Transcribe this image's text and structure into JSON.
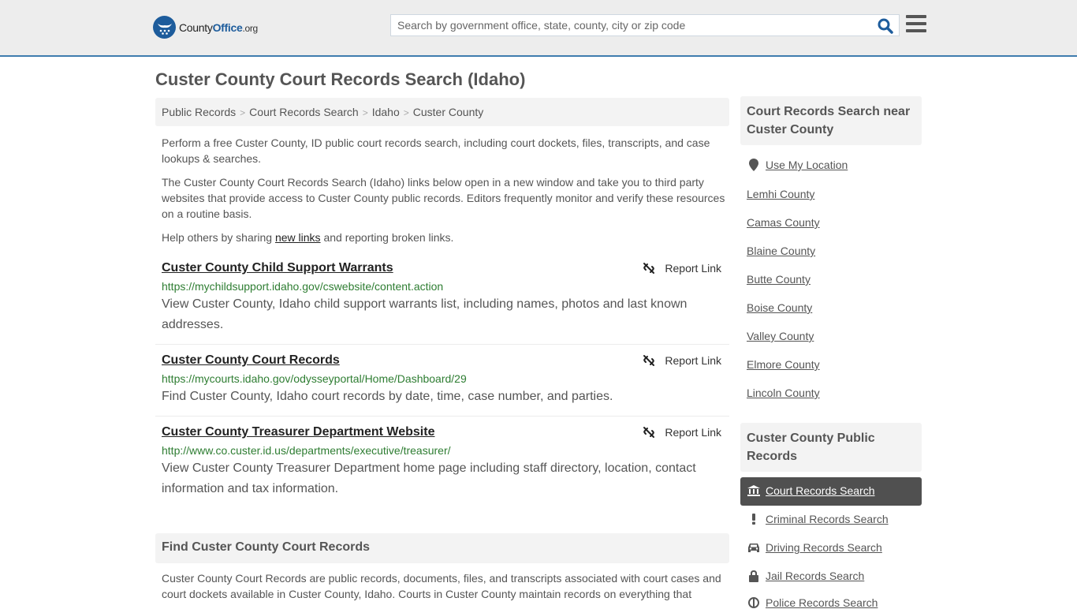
{
  "header": {
    "logo": {
      "name_part1": "County",
      "name_part2": "Office",
      "name_part3": ".org"
    },
    "search": {
      "placeholder": "Search by government office, state, county, city or zip code",
      "value": ""
    },
    "colors": {
      "brand": "#1d5c9c",
      "header_border": "#3f7cae"
    }
  },
  "page": {
    "title": "Custer County Court Records Search (Idaho)",
    "breadcrumb": [
      "Public Records",
      "Court Records Search",
      "Idaho",
      "Custer County"
    ],
    "intro": {
      "p1": "Perform a free Custer County, ID public court records search, including court dockets, files, transcripts, and case lookups & searches.",
      "p2": "The Custer County Court Records Search (Idaho) links below open in a new window and take you to third party websites that provide access to Custer County public records. Editors frequently monitor and verify these resources on a routine basis.",
      "p3_before": "Help others by sharing ",
      "p3_link": "new links",
      "p3_after": " and reporting broken links."
    },
    "report_label": "Report Link",
    "entries": [
      {
        "title": "Custer County Child Support Warrants",
        "url": "https://mychildsupport.idaho.gov/cswebsite/content.action",
        "description": "View Custer County, Idaho child support warrants list, including names, photos and last known addresses."
      },
      {
        "title": "Custer County Court Records",
        "url": "https://mycourts.idaho.gov/odysseyportal/Home/Dashboard/29",
        "description": "Find Custer County, Idaho court records by date, time, case number, and parties."
      },
      {
        "title": "Custer County Treasurer Department Website",
        "url": "http://www.co.custer.id.us/departments/executive/treasurer/",
        "description": "View Custer County Treasurer Department home page including staff directory, location, contact information and tax information."
      }
    ],
    "find_section": {
      "heading": "Find Custer County Court Records",
      "body": "Custer County Court Records are public records, documents, files, and transcripts associated with court cases and court dockets available in Custer County, Idaho. Courts in Custer County maintain records on everything that"
    }
  },
  "sidebar": {
    "nearby_heading": "Court Records Search near Custer County",
    "use_location": "Use My Location",
    "nearby": [
      "Lemhi County",
      "Camas County",
      "Blaine County",
      "Butte County",
      "Boise County",
      "Valley County",
      "Elmore County",
      "Lincoln County"
    ],
    "public_heading": "Custer County Public Records",
    "public_links": [
      {
        "label": "Court Records Search",
        "icon": "courthouse-icon",
        "active": true
      },
      {
        "label": "Criminal Records Search",
        "icon": "exclamation-icon",
        "active": false
      },
      {
        "label": "Driving Records Search",
        "icon": "car-icon",
        "active": false
      },
      {
        "label": "Jail Records Search",
        "icon": "lock-icon",
        "active": false
      },
      {
        "label": "Police Records Search",
        "icon": "police-icon",
        "active": false
      }
    ]
  }
}
